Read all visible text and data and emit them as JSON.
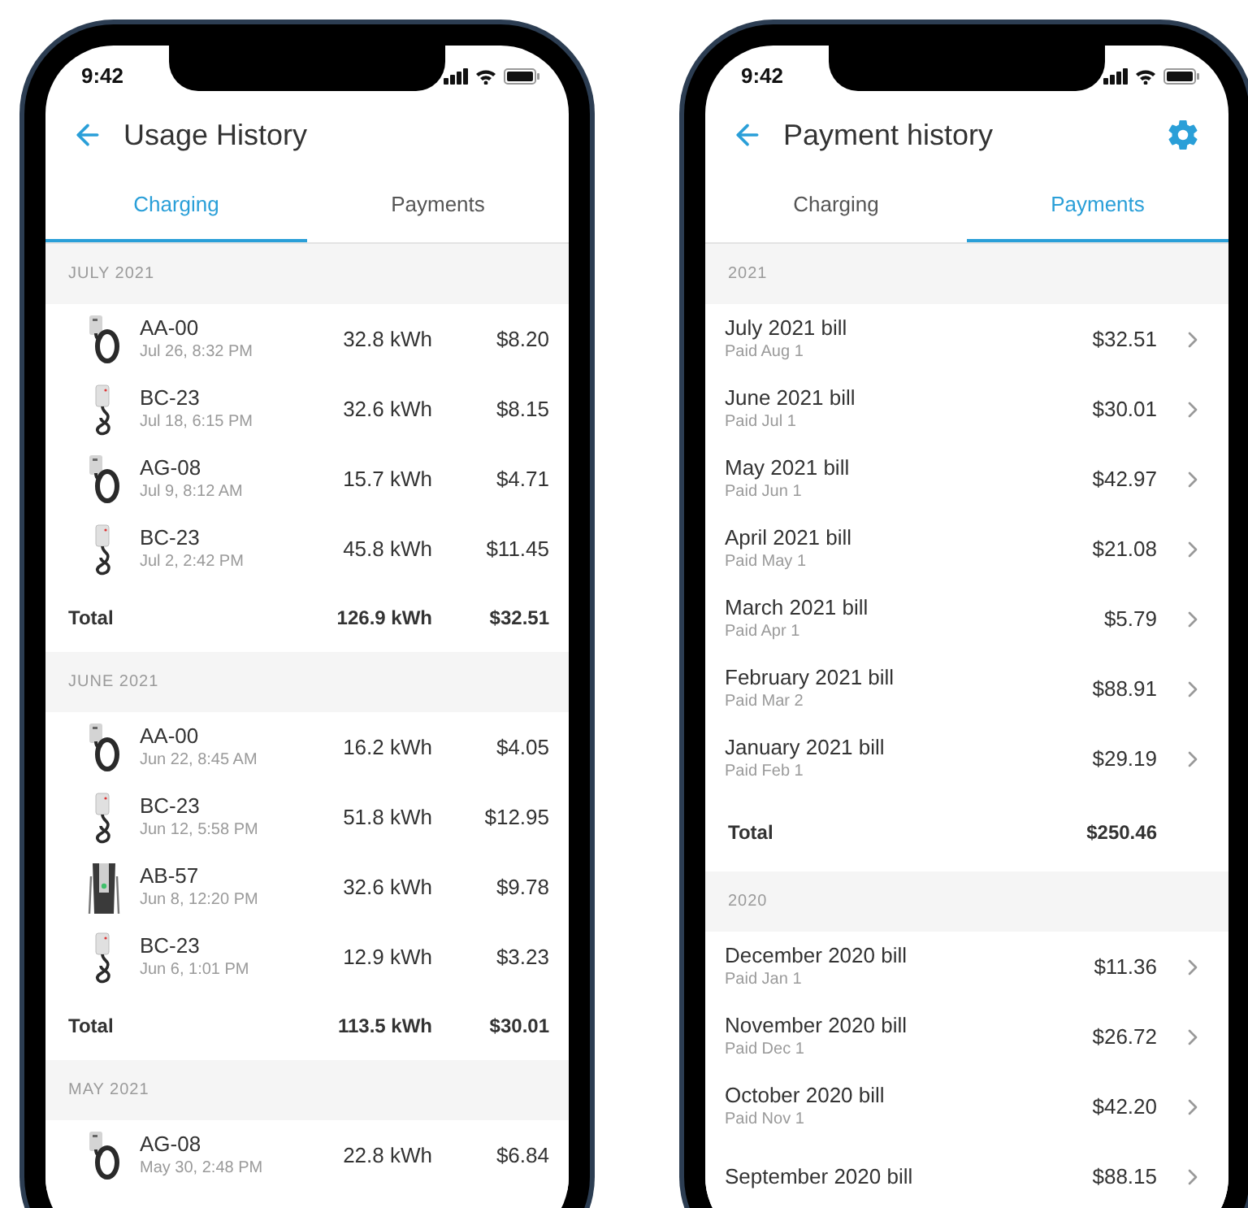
{
  "phones": [
    {
      "time": "9:42",
      "title": "Usage History",
      "tabs": [
        {
          "label": "Charging",
          "selected": true
        },
        {
          "label": "Payments",
          "selected": false
        }
      ],
      "sections": [
        {
          "heading": "JULY 2021",
          "rows": [
            {
              "kind": "wall-round",
              "name": "AA-00",
              "date": "Jul 26, 8:32 PM",
              "energy": "32.8 kWh",
              "amount": "$8.20"
            },
            {
              "kind": "wall-slim",
              "name": "BC-23",
              "date": "Jul 18, 6:15 PM",
              "energy": "32.6 kWh",
              "amount": "$8.15"
            },
            {
              "kind": "wall-round",
              "name": "AG-08",
              "date": "Jul 9, 8:12 AM",
              "energy": "15.7 kWh",
              "amount": "$4.71"
            },
            {
              "kind": "wall-slim",
              "name": "BC-23",
              "date": "Jul 2, 2:42 PM",
              "energy": "45.8 kWh",
              "amount": "$11.45"
            }
          ],
          "total": {
            "label": "Total",
            "energy": "126.9 kWh",
            "amount": "$32.51"
          }
        },
        {
          "heading": "JUNE 2021",
          "rows": [
            {
              "kind": "wall-round",
              "name": "AA-00",
              "date": "Jun 22, 8:45 AM",
              "energy": "16.2 kWh",
              "amount": "$4.05"
            },
            {
              "kind": "wall-slim",
              "name": "BC-23",
              "date": "Jun 12, 5:58 PM",
              "energy": "51.8 kWh",
              "amount": "$12.95"
            },
            {
              "kind": "pedestal",
              "name": "AB-57",
              "date": "Jun 8, 12:20 PM",
              "energy": "32.6 kWh",
              "amount": "$9.78"
            },
            {
              "kind": "wall-slim",
              "name": "BC-23",
              "date": "Jun 6, 1:01 PM",
              "energy": "12.9 kWh",
              "amount": "$3.23"
            }
          ],
          "total": {
            "label": "Total",
            "energy": "113.5 kWh",
            "amount": "$30.01"
          }
        },
        {
          "heading": "MAY 2021",
          "rows": [
            {
              "kind": "wall-round",
              "name": "AG-08",
              "date": "May 30, 2:48 PM",
              "energy": "22.8 kWh",
              "amount": "$6.84"
            }
          ]
        }
      ]
    },
    {
      "time": "9:42",
      "title": "Payment history",
      "settings_button": true,
      "tabs": [
        {
          "label": "Charging",
          "selected": false
        },
        {
          "label": "Payments",
          "selected": true
        }
      ],
      "sections": [
        {
          "heading": "2021",
          "rows": [
            {
              "kind": "bill",
              "name": "July 2021 bill",
              "date": "Paid Aug 1",
              "amount": "$32.51"
            },
            {
              "kind": "bill",
              "name": "June 2021 bill",
              "date": "Paid Jul 1",
              "amount": "$30.01"
            },
            {
              "kind": "bill",
              "name": "May 2021 bill",
              "date": "Paid Jun 1",
              "amount": "$42.97"
            },
            {
              "kind": "bill",
              "name": "April 2021 bill",
              "date": "Paid May 1",
              "amount": "$21.08"
            },
            {
              "kind": "bill",
              "name": "March 2021 bill",
              "date": "Paid Apr 1",
              "amount": "$5.79"
            },
            {
              "kind": "bill",
              "name": "February 2021 bill",
              "date": "Paid Mar 2",
              "amount": "$88.91"
            },
            {
              "kind": "bill",
              "name": "January 2021 bill",
              "date": "Paid Feb 1",
              "amount": "$29.19"
            }
          ],
          "total": {
            "label": "Total",
            "amount": "$250.46"
          }
        },
        {
          "heading": "2020",
          "rows": [
            {
              "kind": "bill",
              "name": "December 2020 bill",
              "date": "Paid Jan 1",
              "amount": "$11.36"
            },
            {
              "kind": "bill",
              "name": "November 2020 bill",
              "date": "Paid Dec 1",
              "amount": "$26.72"
            },
            {
              "kind": "bill",
              "name": "October 2020 bill",
              "date": "Paid Nov 1",
              "amount": "$42.20"
            },
            {
              "kind": "bill",
              "name": "September 2020 bill",
              "amount": "$88.15"
            }
          ]
        }
      ]
    }
  ]
}
